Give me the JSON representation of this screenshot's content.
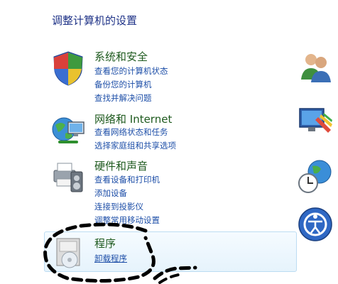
{
  "page": {
    "title": "调整计算机的设置"
  },
  "categories": [
    {
      "title": "系统和安全",
      "icon": "shield-icon",
      "links": [
        "查看您的计算机状态",
        "备份您的计算机",
        "查找并解决问题"
      ]
    },
    {
      "title": "网络和 Internet",
      "icon": "network-globe-icon",
      "links": [
        "查看网络状态和任务",
        "选择家庭组和共享选项"
      ]
    },
    {
      "title": "硬件和声音",
      "icon": "printer-speaker-icon",
      "links": [
        "查看设备和打印机",
        "添加设备",
        "连接到投影仪",
        "调整常用移动设置"
      ]
    },
    {
      "title": "程序",
      "icon": "programs-disc-icon",
      "links": [
        "卸载程序"
      ]
    }
  ],
  "right_icons": [
    "user-accounts-icon",
    "appearance-icon",
    "clock-globe-icon",
    "ease-of-access-icon"
  ],
  "colors": {
    "title": "#1e3287",
    "category_title": "#1e5a1e",
    "link": "#1e4fa8",
    "selected_border": "#bcdcf2"
  }
}
